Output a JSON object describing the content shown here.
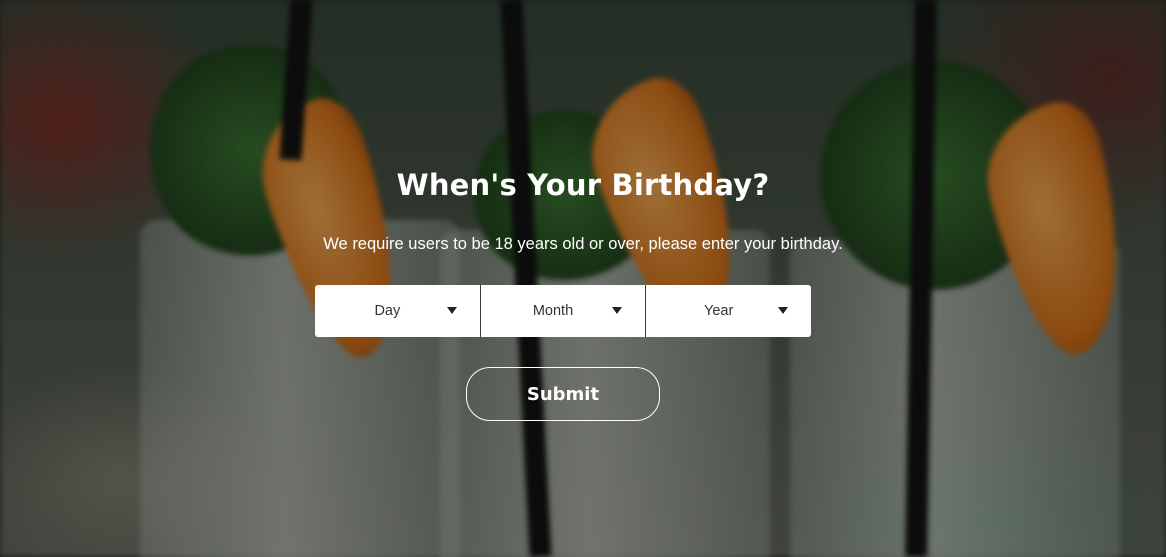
{
  "age_gate": {
    "title": "When's Your Birthday?",
    "subtitle": "We require users to be 18 years old or over, please enter your birthday.",
    "selects": {
      "day": {
        "placeholder": "Day",
        "icon": "caret-down-icon"
      },
      "month": {
        "placeholder": "Month",
        "icon": "caret-down-icon"
      },
      "year": {
        "placeholder": "Year",
        "icon": "caret-down-icon"
      }
    },
    "submit_label": "Submit"
  },
  "colors": {
    "text": "#ffffff",
    "select_background": "#ffffff",
    "select_text": "#333333",
    "overlay": "rgba(0,0,0,0.38)"
  }
}
